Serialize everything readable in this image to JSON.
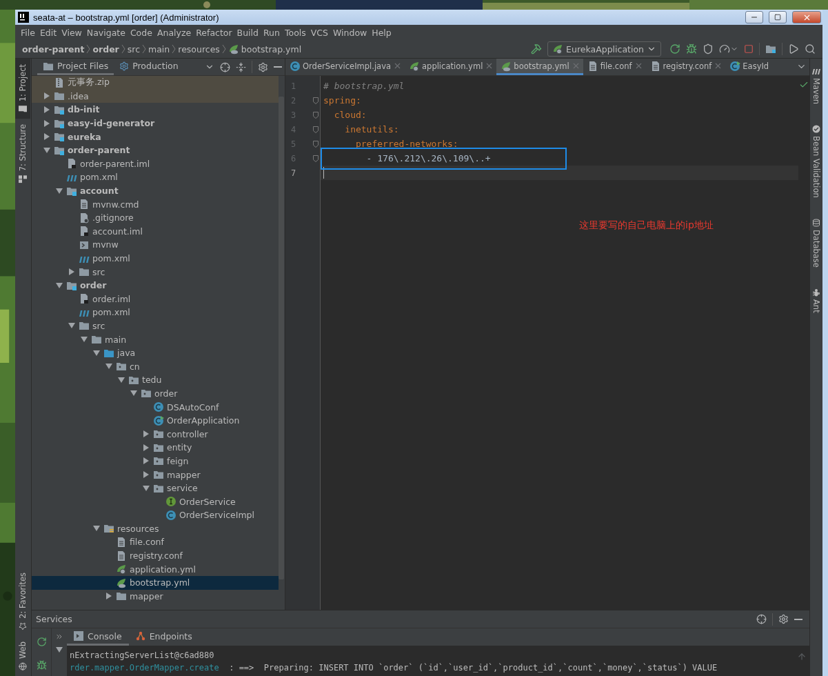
{
  "window": {
    "title": "seata-at – bootstrap.yml [order] (Administrator)"
  },
  "menu": [
    "File",
    "Edit",
    "View",
    "Navigate",
    "Code",
    "Analyze",
    "Refactor",
    "Build",
    "Run",
    "Tools",
    "VCS",
    "Window",
    "Help"
  ],
  "breadcrumbs": [
    {
      "label": "order-parent",
      "kind": "module"
    },
    {
      "label": "order",
      "kind": "module"
    },
    {
      "label": "src",
      "kind": "folder"
    },
    {
      "label": "main",
      "kind": "folder"
    },
    {
      "label": "resources",
      "kind": "folder"
    },
    {
      "label": "bootstrap.yml",
      "kind": "spring-config"
    }
  ],
  "run_config": "EurekaApplication",
  "left_tools": [
    {
      "label": "1: Project",
      "kind": "project",
      "selected": true
    },
    {
      "label": "7: Structure",
      "kind": "structure",
      "selected": false
    }
  ],
  "left_tools_bottom": [
    {
      "label": "2: Favorites",
      "kind": "favorites",
      "selected": false
    },
    {
      "label": "Web",
      "kind": "web",
      "selected": false
    }
  ],
  "right_tools": [
    {
      "label": "Maven",
      "kind": "maven"
    },
    {
      "label": "Bean Validation",
      "kind": "bean"
    },
    {
      "label": "Database",
      "kind": "database"
    },
    {
      "label": "Ant",
      "kind": "ant"
    }
  ],
  "project": {
    "tabs": [
      {
        "label": "Project Files",
        "kind": "folder",
        "selected": true
      },
      {
        "label": "Production",
        "kind": "scope",
        "selected": false
      }
    ],
    "tree": [
      {
        "label": "元事务.zip",
        "kind": "zip",
        "selected": false,
        "ignored": true
      },
      {
        "label": ".idea",
        "kind": "folder",
        "expanded": false,
        "selected": false,
        "ignored": true
      },
      {
        "label": "db-init",
        "kind": "module",
        "expanded": false,
        "selected": false,
        "ignored": false
      },
      {
        "label": "easy-id-generator",
        "kind": "module",
        "expanded": false,
        "selected": false,
        "ignored": false
      },
      {
        "label": "eureka",
        "kind": "module",
        "expanded": false,
        "selected": false,
        "ignored": false
      },
      {
        "label": "order-parent",
        "kind": "module",
        "expanded": true,
        "selected": false,
        "ignored": false,
        "children": [
          {
            "label": "order-parent.iml",
            "kind": "iml",
            "selected": false,
            "ignored": false
          },
          {
            "label": "pom.xml",
            "kind": "maven",
            "selected": false,
            "ignored": false
          },
          {
            "label": "account",
            "kind": "module",
            "expanded": true,
            "selected": false,
            "ignored": false,
            "children": [
              {
                "label": "mvnw.cmd",
                "kind": "text",
                "selected": false,
                "ignored": false
              },
              {
                "label": ".gitignore",
                "kind": "ignore-file",
                "selected": false,
                "ignored": false
              },
              {
                "label": "account.iml",
                "kind": "iml",
                "selected": false,
                "ignored": false
              },
              {
                "label": "mvnw",
                "kind": "shell",
                "selected": false,
                "ignored": false
              },
              {
                "label": "pom.xml",
                "kind": "maven",
                "selected": false,
                "ignored": false
              },
              {
                "label": "src",
                "kind": "folder",
                "expanded": false,
                "selected": false,
                "ignored": false
              }
            ]
          },
          {
            "label": "order",
            "kind": "module",
            "expanded": true,
            "selected": false,
            "ignored": false,
            "children": [
              {
                "label": "order.iml",
                "kind": "iml",
                "selected": false,
                "ignored": false
              },
              {
                "label": "pom.xml",
                "kind": "maven",
                "selected": false,
                "ignored": false
              },
              {
                "label": "src",
                "kind": "folder",
                "expanded": true,
                "selected": false,
                "ignored": false,
                "children": [
                  {
                    "label": "main",
                    "kind": "folder",
                    "expanded": true,
                    "selected": false,
                    "ignored": false,
                    "children": [
                      {
                        "label": "java",
                        "kind": "source-folder",
                        "expanded": true,
                        "selected": false,
                        "ignored": false,
                        "children": [
                          {
                            "label": "cn",
                            "kind": "package",
                            "expanded": true,
                            "selected": false,
                            "ignored": false,
                            "children": [
                              {
                                "label": "tedu",
                                "kind": "package",
                                "expanded": true,
                                "selected": false,
                                "ignored": false,
                                "children": [
                                  {
                                    "label": "order",
                                    "kind": "package",
                                    "expanded": true,
                                    "selected": false,
                                    "ignored": false,
                                    "children": [
                                      {
                                        "label": "DSAutoConf",
                                        "kind": "class",
                                        "selected": false,
                                        "ignored": false
                                      },
                                      {
                                        "label": "OrderApplication",
                                        "kind": "app-class",
                                        "selected": false,
                                        "ignored": false
                                      },
                                      {
                                        "label": "controller",
                                        "kind": "package",
                                        "expanded": false,
                                        "selected": false,
                                        "ignored": false
                                      },
                                      {
                                        "label": "entity",
                                        "kind": "package",
                                        "expanded": false,
                                        "selected": false,
                                        "ignored": false
                                      },
                                      {
                                        "label": "feign",
                                        "kind": "package",
                                        "expanded": false,
                                        "selected": false,
                                        "ignored": false
                                      },
                                      {
                                        "label": "mapper",
                                        "kind": "package",
                                        "expanded": false,
                                        "selected": false,
                                        "ignored": false
                                      },
                                      {
                                        "label": "service",
                                        "kind": "package",
                                        "expanded": true,
                                        "selected": false,
                                        "ignored": false,
                                        "children": [
                                          {
                                            "label": "OrderService",
                                            "kind": "interface",
                                            "selected": false,
                                            "ignored": false
                                          },
                                          {
                                            "label": "OrderServiceImpl",
                                            "kind": "class",
                                            "selected": false,
                                            "ignored": false
                                          }
                                        ]
                                      }
                                    ]
                                  }
                                ]
                              }
                            ]
                          }
                        ]
                      },
                      {
                        "label": "resources",
                        "kind": "resource-folder",
                        "expanded": true,
                        "selected": false,
                        "ignored": false,
                        "children": [
                          {
                            "label": "file.conf",
                            "kind": "text",
                            "selected": false,
                            "ignored": false
                          },
                          {
                            "label": "registry.conf",
                            "kind": "text",
                            "selected": false,
                            "ignored": false
                          },
                          {
                            "label": "application.yml",
                            "kind": "spring-app-config",
                            "selected": false,
                            "ignored": false
                          },
                          {
                            "label": "bootstrap.yml",
                            "kind": "spring-config",
                            "selected": true,
                            "ignored": false
                          },
                          {
                            "label": "mapper",
                            "kind": "folder",
                            "expanded": false,
                            "selected": false,
                            "ignored": false
                          }
                        ]
                      }
                    ]
                  }
                ]
              }
            ]
          }
        ]
      }
    ]
  },
  "editor": {
    "tabs": [
      {
        "label": "OrderServiceImpl.java",
        "kind": "class",
        "selected": false
      },
      {
        "label": "application.yml",
        "kind": "spring-app-config",
        "selected": false
      },
      {
        "label": "bootstrap.yml",
        "kind": "spring-config",
        "selected": true
      },
      {
        "label": "file.conf",
        "kind": "text",
        "selected": false
      },
      {
        "label": "registry.conf",
        "kind": "text",
        "selected": false
      },
      {
        "label": "EasyId",
        "kind": "app-class",
        "selected": false
      }
    ],
    "lines": [
      {
        "number": "1",
        "foldable": false,
        "current": false,
        "boxed": false,
        "tokens": [
          {
            "kind": "comment",
            "text": "# bootstrap.yml"
          }
        ]
      },
      {
        "number": "2",
        "foldable": true,
        "current": false,
        "boxed": false,
        "tokens": [
          {
            "kind": "key",
            "text": "spring:"
          }
        ]
      },
      {
        "number": "3",
        "foldable": true,
        "current": false,
        "boxed": false,
        "tokens": [
          {
            "kind": "key",
            "text": "  cloud:"
          }
        ]
      },
      {
        "number": "4",
        "foldable": true,
        "current": false,
        "boxed": false,
        "tokens": [
          {
            "kind": "key",
            "text": "    inetutils:"
          }
        ]
      },
      {
        "number": "5",
        "foldable": true,
        "current": false,
        "boxed": false,
        "tokens": [
          {
            "kind": "key",
            "text": "      preferred-networks:"
          }
        ]
      },
      {
        "number": "6",
        "foldable": true,
        "current": false,
        "boxed": true,
        "tokens": [
          {
            "kind": "value",
            "text": "        - 176\\.212\\.26\\.109\\..+"
          }
        ]
      },
      {
        "number": "7",
        "foldable": false,
        "current": true,
        "boxed": false
      }
    ],
    "note": "这里要写的自己电脑上的ip地址"
  },
  "services": {
    "title": "Services",
    "tabs": [
      {
        "label": "Console",
        "kind": "console",
        "selected": true
      },
      {
        "label": "Endpoints",
        "kind": "endpoints",
        "selected": false
      }
    ],
    "console": [
      [
        {
          "kind": "plain",
          "text": "nExtractingServerList@c6ad880"
        }
      ],
      [
        {
          "kind": "logger",
          "text": "rder.mapper.OrderMapper.create"
        },
        {
          "kind": "plain",
          "text": "  : ==>  Preparing: INSERT INTO `order` (`id`,`user_id`,`product_id`,`count`,`money`,`status`) VALUE"
        }
      ]
    ]
  }
}
